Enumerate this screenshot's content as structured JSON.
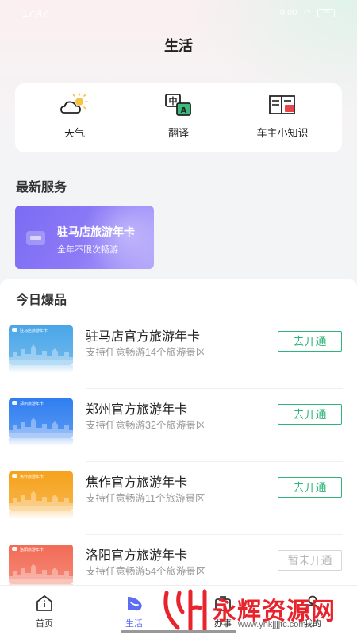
{
  "status_bar": {
    "time": "17:47",
    "net_speed": "0.00",
    "battery": "76"
  },
  "page": {
    "title": "生活"
  },
  "tools": [
    {
      "label": "天气",
      "icon": "weather-icon"
    },
    {
      "label": "翻译",
      "icon": "translate-icon"
    },
    {
      "label": "车主小知识",
      "icon": "book-icon"
    }
  ],
  "latest_services": {
    "title": "最新服务",
    "card": {
      "title": "驻马店旅游年卡",
      "subtitle": "全年不限次畅游"
    }
  },
  "today_hot": {
    "title": "今日爆品",
    "items": [
      {
        "name": "驻马店官方旅游年卡",
        "desc": "支持任意畅游14个旅游景区",
        "button": "去开通",
        "enabled": true,
        "color": "#4aa6e8",
        "card_text": "驻马店旅游年卡"
      },
      {
        "name": "郑州官方旅游年卡",
        "desc": "支持任意畅游32个旅游景区",
        "button": "去开通",
        "enabled": true,
        "color": "#2f7ef0",
        "card_text": "郑州旅游年卡"
      },
      {
        "name": "焦作官方旅游年卡",
        "desc": "支持任意畅游11个旅游景区",
        "button": "去开通",
        "enabled": true,
        "color": "#f6a21c",
        "card_text": "焦作旅游年卡"
      },
      {
        "name": "洛阳官方旅游年卡",
        "desc": "支持任意畅游54个旅游景区",
        "button": "暂未开通",
        "enabled": false,
        "color": "#f26b55",
        "card_text": "洛阳旅游年卡"
      }
    ]
  },
  "tabbar": {
    "items": [
      {
        "label": "首页",
        "active": false
      },
      {
        "label": "生活",
        "active": true
      },
      {
        "label": "办事",
        "active": false
      },
      {
        "label": "我的",
        "active": false
      }
    ]
  },
  "watermark": {
    "text": "永辉资源网",
    "url": "www.yhkjjjjtc.com"
  },
  "colors": {
    "accent": "#2fb37a",
    "tab_active": "#5b6df2",
    "service_card": "#7b6bf3"
  }
}
